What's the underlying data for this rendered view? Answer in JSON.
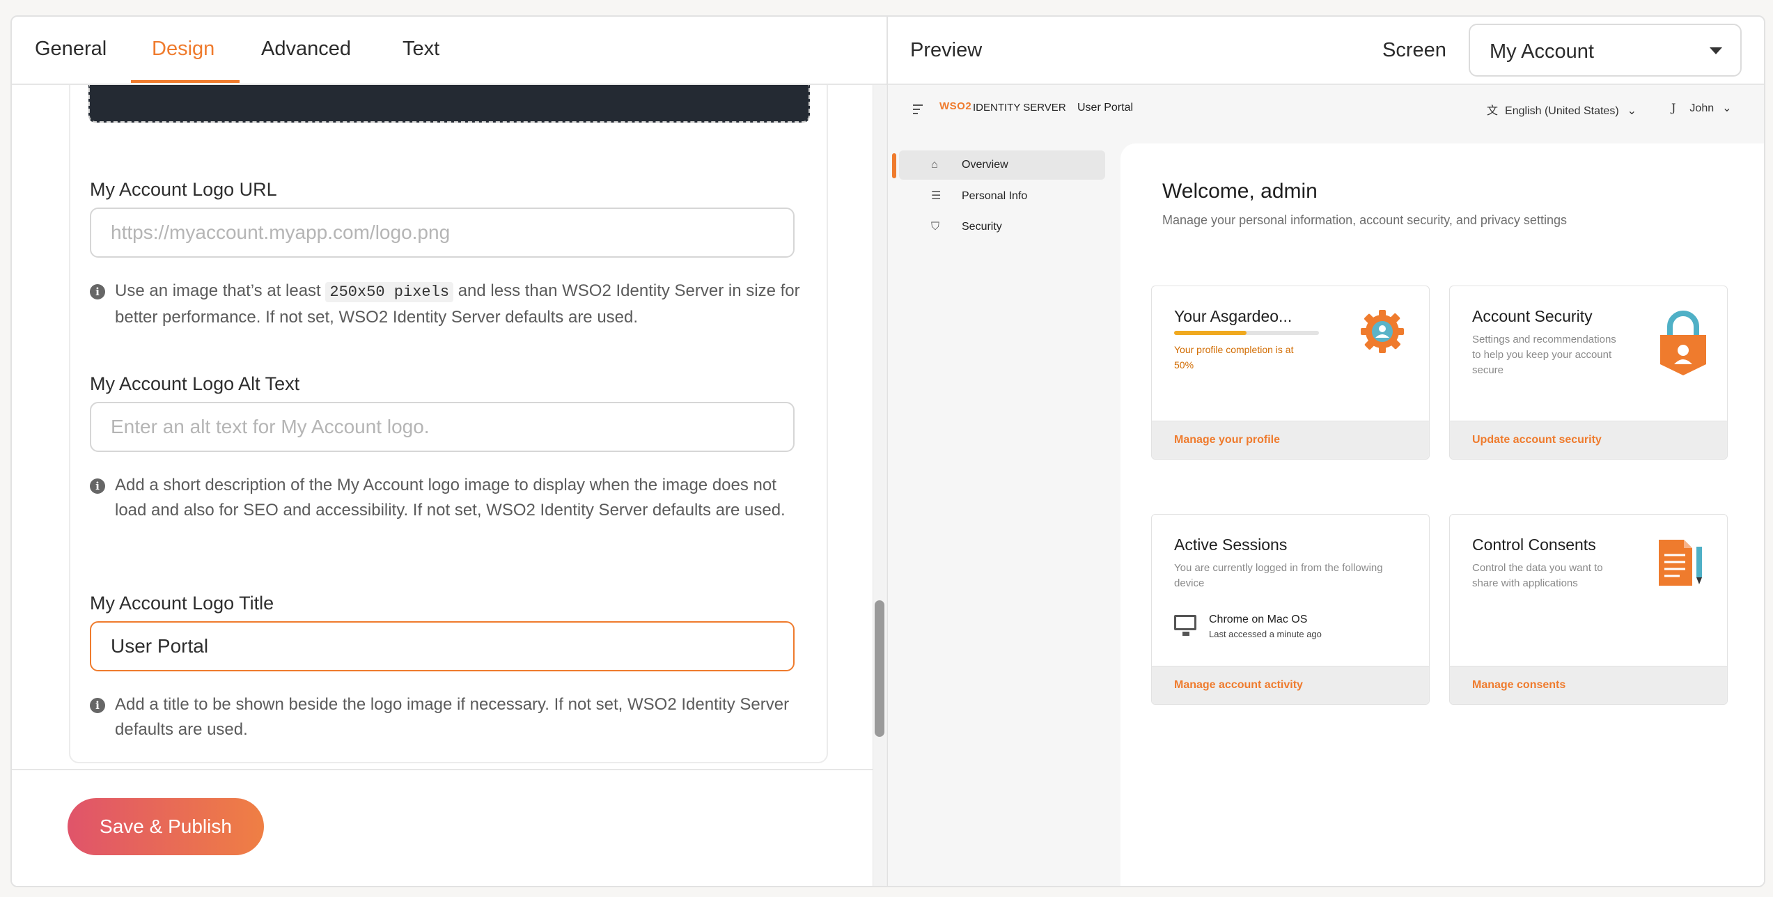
{
  "tabs": [
    {
      "label": "General"
    },
    {
      "label": "Design"
    },
    {
      "label": "Advanced"
    },
    {
      "label": "Text"
    }
  ],
  "active_tab": "Design",
  "fields": {
    "logo_url": {
      "label": "My Account Logo URL",
      "placeholder": "https://myaccount.myapp.com/logo.png",
      "value": "",
      "hint_before": "Use an image that’s at least ",
      "hint_code": "250x50 pixels",
      "hint_after": " and less than WSO2 Identity Server in size for better performance. If not set, WSO2 Identity Server defaults are used."
    },
    "logo_alt": {
      "label": "My Account Logo Alt Text",
      "placeholder": "Enter an alt text for My Account logo.",
      "value": "",
      "hint": "Add a short description of the My Account logo image to display when the image does not load and also for SEO and accessibility. If not set, WSO2 Identity Server defaults are used."
    },
    "logo_title": {
      "label": "My Account Logo Title",
      "value": "User Portal",
      "hint": "Add a title to be shown beside the logo image if necessary. If not set, WSO2 Identity Server defaults are used."
    }
  },
  "footer": {
    "save_label": "Save & Publish"
  },
  "preview": {
    "title": "Preview",
    "screen_label": "Screen",
    "screen_value": "My Account",
    "portal": {
      "logo": "WSO2",
      "product": "IDENTITY SERVER",
      "name": "User Portal",
      "language": "English (United States)",
      "user_initial": "J",
      "user_name": "John",
      "nav": [
        {
          "label": "Overview",
          "icon": "home-icon"
        },
        {
          "label": "Personal Info",
          "icon": "id-card-icon"
        },
        {
          "label": "Security",
          "icon": "shield-icon"
        }
      ],
      "welcome": "Welcome, admin",
      "welcome_sub": "Manage your personal information, account security, and privacy settings",
      "cards": [
        {
          "title": "Your Asgardeo...",
          "progress_text": "Your profile completion is at 50%",
          "progress": 0.5,
          "link": "Manage your profile",
          "icon": "gear-user-icon"
        },
        {
          "title": "Account Security",
          "desc": "Settings and recommendations to help you keep your account secure",
          "link": "Update account security",
          "icon": "lock-icon"
        },
        {
          "title": "Active Sessions",
          "desc": "You are currently logged in from the following device",
          "session_name": "Chrome on Mac OS",
          "session_time": "Last accessed a minute ago",
          "link": "Manage account activity",
          "icon": "monitor-icon"
        },
        {
          "title": "Control Consents",
          "desc": "Control the data you want to share with applications",
          "link": "Manage consents",
          "icon": "document-pencil-icon"
        }
      ]
    }
  },
  "colors": {
    "accent": "#ef7b2d",
    "dark_block": "#242a33",
    "save_gradient_start": "#e0546a",
    "save_gradient_end": "#ef7f44"
  }
}
